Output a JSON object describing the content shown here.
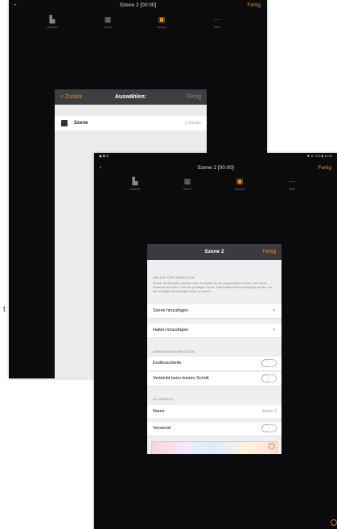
{
  "back": {
    "plus": "+",
    "title": "Szene 2 [00:00]",
    "done": "Fertig",
    "tools": [
      {
        "label": "Leuchten",
        "icon": "lamp-icon"
      },
      {
        "label": "Szene",
        "icon": "scene-icon"
      },
      {
        "label": "Szenen",
        "icon": "scenes-icon"
      },
      {
        "label": "Mehr",
        "icon": "more-icon"
      }
    ],
    "dialog": {
      "back": "< Zurück",
      "title": "Auswählen:",
      "done": "Fertig",
      "row": {
        "label": "Szene",
        "value": "2 Geräte"
      }
    }
  },
  "side_text": "t",
  "front": {
    "status_left": "▣ ⧉ ◎",
    "status_right": "✱ ≋ 71% ▮ 14:25",
    "plus": "+",
    "title": "Szene 2 [00:00]",
    "done": "Fertig",
    "tools": [
      {
        "label": "Leuchten",
        "icon": "lamp-icon"
      },
      {
        "label": "Szene",
        "icon": "scene-icon"
      },
      {
        "label": "Szenen",
        "icon": "scenes-icon"
      },
      {
        "label": "Mehr",
        "icon": "more-icon"
      }
    ],
    "dialog": {
      "title": "Szene 2",
      "done": "Fertig",
      "section1": "ABLAUF DER ANIMATION",
      "description": "Sobald die Animation aktiviert wird, durchläuft sie die ausgewählten Szenen. Die Dauer bestimmt die Fade-In Zeit der jeweiligen Szene. Wartezeiten können eingefügt werden, um die vorherige Szene länger laufen zu lassen.",
      "add_scene": "Szene hinzufügen",
      "add_hold": "Halten hinzufügen",
      "arrow": ">",
      "section2": "ANIMATIONSVERHALTEN",
      "loop": "Endlosschleife",
      "stay_last": "Verbleibt beim letzten Schritt",
      "section3": "ALLGEMEIN",
      "name_label": "Name",
      "name_value": "Szene 2",
      "hidden": "Versteckt",
      "toggles": {
        "loop": false,
        "stay_last": false,
        "hidden": false
      }
    }
  },
  "colors": {
    "accent": "#f0901e",
    "header": "#3a3a3f"
  }
}
